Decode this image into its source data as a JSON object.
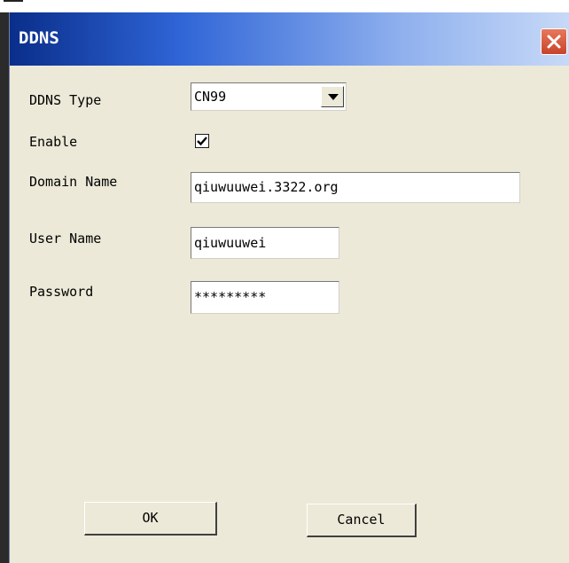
{
  "dialog": {
    "title": "DDNS",
    "close_icon": "close-icon"
  },
  "form": {
    "ddns_type": {
      "label": "DDNS Type",
      "value": "CN99"
    },
    "enable": {
      "label": "Enable",
      "checked": true
    },
    "domain_name": {
      "label": "Domain Name",
      "value": "qiuwuuwei.3322.org"
    },
    "user_name": {
      "label": "User Name",
      "value": "qiuwuuwei"
    },
    "password": {
      "label": "Password",
      "value": "*********"
    }
  },
  "buttons": {
    "ok": "OK",
    "cancel": "Cancel"
  }
}
